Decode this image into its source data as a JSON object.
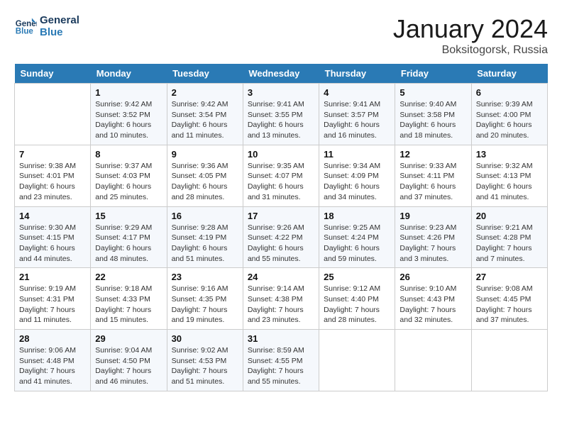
{
  "header": {
    "logo_line1": "General",
    "logo_line2": "Blue",
    "title": "January 2024",
    "subtitle": "Boksitogorsk, Russia"
  },
  "days_of_week": [
    "Sunday",
    "Monday",
    "Tuesday",
    "Wednesday",
    "Thursday",
    "Friday",
    "Saturday"
  ],
  "weeks": [
    [
      {
        "num": "",
        "detail": ""
      },
      {
        "num": "1",
        "detail": "Sunrise: 9:42 AM\nSunset: 3:52 PM\nDaylight: 6 hours\nand 10 minutes."
      },
      {
        "num": "2",
        "detail": "Sunrise: 9:42 AM\nSunset: 3:54 PM\nDaylight: 6 hours\nand 11 minutes."
      },
      {
        "num": "3",
        "detail": "Sunrise: 9:41 AM\nSunset: 3:55 PM\nDaylight: 6 hours\nand 13 minutes."
      },
      {
        "num": "4",
        "detail": "Sunrise: 9:41 AM\nSunset: 3:57 PM\nDaylight: 6 hours\nand 16 minutes."
      },
      {
        "num": "5",
        "detail": "Sunrise: 9:40 AM\nSunset: 3:58 PM\nDaylight: 6 hours\nand 18 minutes."
      },
      {
        "num": "6",
        "detail": "Sunrise: 9:39 AM\nSunset: 4:00 PM\nDaylight: 6 hours\nand 20 minutes."
      }
    ],
    [
      {
        "num": "7",
        "detail": "Sunrise: 9:38 AM\nSunset: 4:01 PM\nDaylight: 6 hours\nand 23 minutes."
      },
      {
        "num": "8",
        "detail": "Sunrise: 9:37 AM\nSunset: 4:03 PM\nDaylight: 6 hours\nand 25 minutes."
      },
      {
        "num": "9",
        "detail": "Sunrise: 9:36 AM\nSunset: 4:05 PM\nDaylight: 6 hours\nand 28 minutes."
      },
      {
        "num": "10",
        "detail": "Sunrise: 9:35 AM\nSunset: 4:07 PM\nDaylight: 6 hours\nand 31 minutes."
      },
      {
        "num": "11",
        "detail": "Sunrise: 9:34 AM\nSunset: 4:09 PM\nDaylight: 6 hours\nand 34 minutes."
      },
      {
        "num": "12",
        "detail": "Sunrise: 9:33 AM\nSunset: 4:11 PM\nDaylight: 6 hours\nand 37 minutes."
      },
      {
        "num": "13",
        "detail": "Sunrise: 9:32 AM\nSunset: 4:13 PM\nDaylight: 6 hours\nand 41 minutes."
      }
    ],
    [
      {
        "num": "14",
        "detail": "Sunrise: 9:30 AM\nSunset: 4:15 PM\nDaylight: 6 hours\nand 44 minutes."
      },
      {
        "num": "15",
        "detail": "Sunrise: 9:29 AM\nSunset: 4:17 PM\nDaylight: 6 hours\nand 48 minutes."
      },
      {
        "num": "16",
        "detail": "Sunrise: 9:28 AM\nSunset: 4:19 PM\nDaylight: 6 hours\nand 51 minutes."
      },
      {
        "num": "17",
        "detail": "Sunrise: 9:26 AM\nSunset: 4:22 PM\nDaylight: 6 hours\nand 55 minutes."
      },
      {
        "num": "18",
        "detail": "Sunrise: 9:25 AM\nSunset: 4:24 PM\nDaylight: 6 hours\nand 59 minutes."
      },
      {
        "num": "19",
        "detail": "Sunrise: 9:23 AM\nSunset: 4:26 PM\nDaylight: 7 hours\nand 3 minutes."
      },
      {
        "num": "20",
        "detail": "Sunrise: 9:21 AM\nSunset: 4:28 PM\nDaylight: 7 hours\nand 7 minutes."
      }
    ],
    [
      {
        "num": "21",
        "detail": "Sunrise: 9:19 AM\nSunset: 4:31 PM\nDaylight: 7 hours\nand 11 minutes."
      },
      {
        "num": "22",
        "detail": "Sunrise: 9:18 AM\nSunset: 4:33 PM\nDaylight: 7 hours\nand 15 minutes."
      },
      {
        "num": "23",
        "detail": "Sunrise: 9:16 AM\nSunset: 4:35 PM\nDaylight: 7 hours\nand 19 minutes."
      },
      {
        "num": "24",
        "detail": "Sunrise: 9:14 AM\nSunset: 4:38 PM\nDaylight: 7 hours\nand 23 minutes."
      },
      {
        "num": "25",
        "detail": "Sunrise: 9:12 AM\nSunset: 4:40 PM\nDaylight: 7 hours\nand 28 minutes."
      },
      {
        "num": "26",
        "detail": "Sunrise: 9:10 AM\nSunset: 4:43 PM\nDaylight: 7 hours\nand 32 minutes."
      },
      {
        "num": "27",
        "detail": "Sunrise: 9:08 AM\nSunset: 4:45 PM\nDaylight: 7 hours\nand 37 minutes."
      }
    ],
    [
      {
        "num": "28",
        "detail": "Sunrise: 9:06 AM\nSunset: 4:48 PM\nDaylight: 7 hours\nand 41 minutes."
      },
      {
        "num": "29",
        "detail": "Sunrise: 9:04 AM\nSunset: 4:50 PM\nDaylight: 7 hours\nand 46 minutes."
      },
      {
        "num": "30",
        "detail": "Sunrise: 9:02 AM\nSunset: 4:53 PM\nDaylight: 7 hours\nand 51 minutes."
      },
      {
        "num": "31",
        "detail": "Sunrise: 8:59 AM\nSunset: 4:55 PM\nDaylight: 7 hours\nand 55 minutes."
      },
      {
        "num": "",
        "detail": ""
      },
      {
        "num": "",
        "detail": ""
      },
      {
        "num": "",
        "detail": ""
      }
    ]
  ]
}
